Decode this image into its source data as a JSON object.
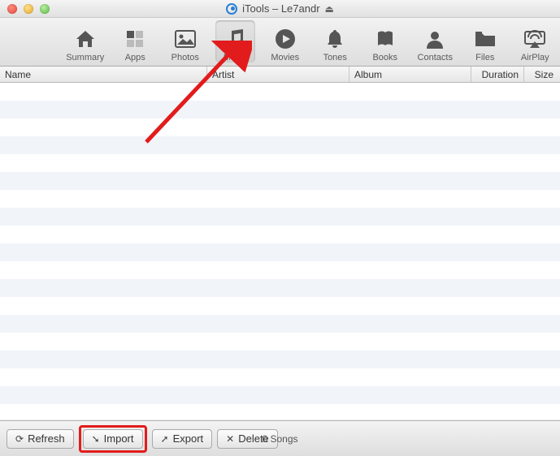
{
  "window": {
    "app_name": "iTools",
    "device_name": "Le7andr",
    "title_separator": " – "
  },
  "toolbar": {
    "items": [
      {
        "id": "summary",
        "label": "Summary"
      },
      {
        "id": "apps",
        "label": "Apps"
      },
      {
        "id": "photos",
        "label": "Photos"
      },
      {
        "id": "music",
        "label": "Music"
      },
      {
        "id": "movies",
        "label": "Movies"
      },
      {
        "id": "tones",
        "label": "Tones"
      },
      {
        "id": "books",
        "label": "Books"
      },
      {
        "id": "contacts",
        "label": "Contacts"
      },
      {
        "id": "files",
        "label": "Files"
      },
      {
        "id": "airplay",
        "label": "AirPlay"
      }
    ],
    "active_index": 3
  },
  "columns": {
    "name": "Name",
    "artist": "Artist",
    "album": "Album",
    "duration": "Duration",
    "size": "Size"
  },
  "rows": [],
  "bottom": {
    "refresh": "Refresh",
    "import": "Import",
    "export": "Export",
    "delete": "Delete",
    "status": "0 Songs"
  },
  "annotation": {
    "highlighted_button": "import",
    "arrow_target": "music"
  }
}
